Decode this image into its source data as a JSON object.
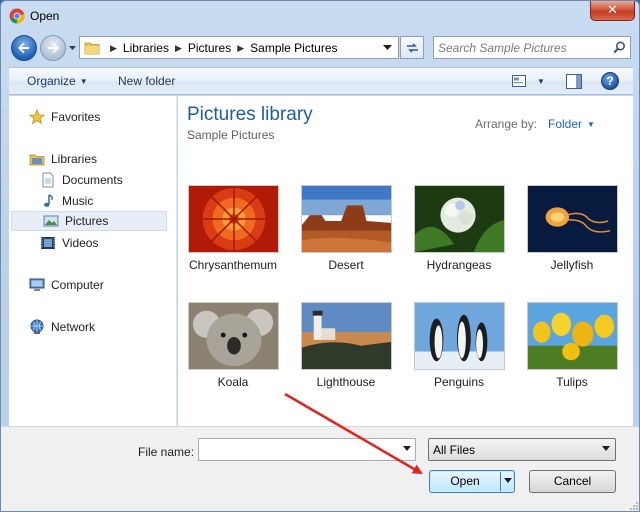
{
  "window": {
    "title": "Open",
    "close_label": "✕"
  },
  "address": {
    "crumbs": [
      "Libraries",
      "Pictures",
      "Sample Pictures"
    ],
    "search_placeholder": "Search Sample Pictures"
  },
  "toolbar": {
    "organize": "Organize",
    "new_folder": "New folder",
    "help": "?"
  },
  "nav": {
    "items": [
      {
        "label": "Favorites",
        "icon": "star-icon"
      },
      {
        "label": "Libraries",
        "icon": "libraries-icon"
      },
      {
        "label": "Documents",
        "icon": "documents-icon"
      },
      {
        "label": "Music",
        "icon": "music-icon"
      },
      {
        "label": "Pictures",
        "icon": "pictures-icon",
        "selected": true
      },
      {
        "label": "Videos",
        "icon": "videos-icon"
      },
      {
        "label": "Computer",
        "icon": "computer-icon"
      },
      {
        "label": "Network",
        "icon": "network-icon"
      }
    ]
  },
  "content": {
    "title": "Pictures library",
    "subtitle": "Sample Pictures",
    "arrange_label": "Arrange by:",
    "arrange_value": "Folder",
    "files": [
      "Chrysanthemum",
      "Desert",
      "Hydrangeas",
      "Jellyfish",
      "Koala",
      "Lighthouse",
      "Penguins",
      "Tulips"
    ]
  },
  "bottom": {
    "file_name_label": "File name:",
    "file_name_value": "",
    "filter_value": "All Files",
    "open_label": "Open",
    "cancel_label": "Cancel"
  },
  "colors": {
    "accent": "#1e5e9e",
    "annotation_arrow": "#e0241b"
  }
}
